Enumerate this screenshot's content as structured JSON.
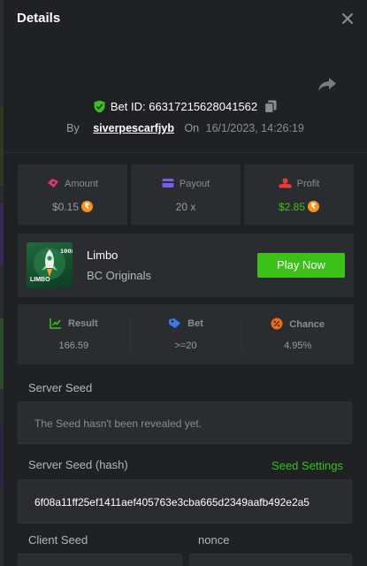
{
  "header": {
    "title": "Details"
  },
  "bet": {
    "id_label": "Bet ID:",
    "id": "66317215628041562",
    "by_label": "By",
    "user": "siverpescarfjyb",
    "on_label": "On",
    "date": "16/1/2023, 14:26:19"
  },
  "stats": {
    "amount_label": "Amount",
    "amount_value": "$0.15",
    "payout_label": "Payout",
    "payout_value": "20 x",
    "profit_label": "Profit",
    "profit_value": "$2.85"
  },
  "game": {
    "name": "Limbo",
    "provider": "BC Originals",
    "thumb_label": "LIMBO",
    "play_label": "Play Now"
  },
  "result": {
    "result_label": "Result",
    "result_value": "166.59",
    "bet_label": "Bet",
    "bet_value": ">=20",
    "chance_label": "Chance",
    "chance_value": "4.95%"
  },
  "seeds": {
    "server_seed_label": "Server Seed",
    "server_seed_value": "The Seed hasn't been revealed yet.",
    "server_hash_label": "Server Seed (hash)",
    "seed_settings_label": "Seed Settings",
    "server_hash_value": "6f08a11ff25ef1411aef405763e3cba665d2349aafb492e2a5",
    "client_seed_label": "Client Seed",
    "nonce_label": "nonce"
  },
  "colors": {
    "accent_green": "#3bc117",
    "panel": "#2a2c30",
    "background": "#1f2125",
    "coin": "#f7931a"
  }
}
